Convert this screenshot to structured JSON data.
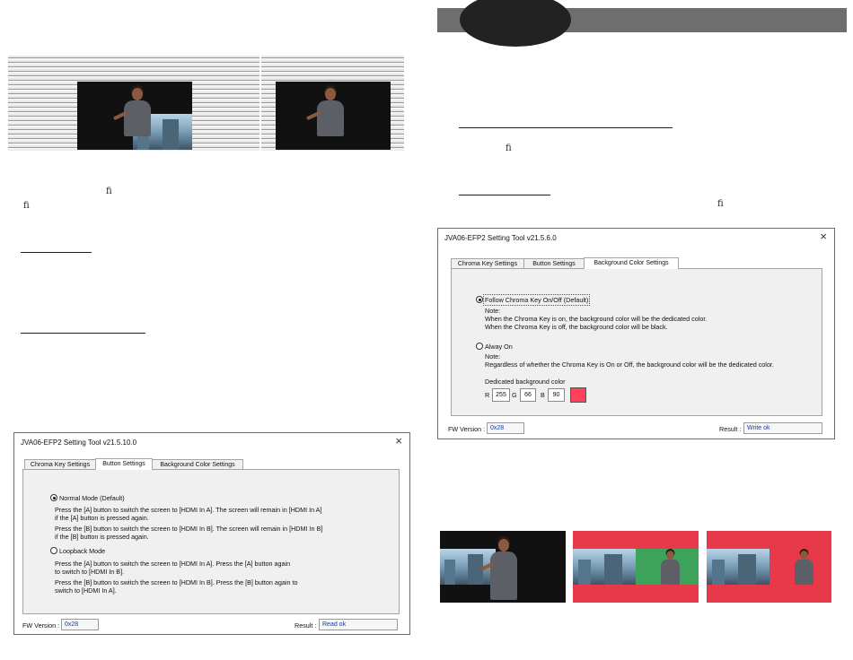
{
  "left_dialog": {
    "title": "JVA06-EFP2 Setting Tool v21.5.10.0",
    "tabs": [
      "Chroma Key Settings",
      "Button Settings",
      "Background Color Settings"
    ],
    "active_tab": "Button Settings",
    "normal_mode_label": "Normal Mode (Default)",
    "normal_lines": [
      "Press the [A] button to switch the screen to [HDMI In A]. The screen will remain in [HDMI In A]",
      "if the [A] button is pressed again.",
      "Press the [B] button to switch the screen to [HDMI In B]. The screen will remain in [HDMI In  B]",
      "if the [B] button is pressed again."
    ],
    "loopback_label": "Loopback Mode",
    "loopback_lines": [
      "Press the [A] button to switch the screen to [HDMI In A]. Press the [A] button again",
      "to switch to [HDMI In B].",
      "Press the [B] button to switch the screen to [HDMI In B]. Press the  [B] button again to",
      "switch to [HDMI In A]."
    ],
    "fw_label": "FW Version :",
    "fw_value": "0x28",
    "result_label": "Result :",
    "result_value": "Read ok"
  },
  "right_dialog": {
    "title": "JVA06-EFP2 Setting Tool v21.5.6.0",
    "tabs": [
      "Chroma Key Settings",
      "Button Settings",
      "Background Color Settings"
    ],
    "active_tab": "Background Color Settings",
    "follow_label": "Follow Chroma Key On/Off (Default)",
    "follow_note": "Note:",
    "follow_lines": [
      "When the Chroma Key is on, the background color will be the dedicated color.",
      "When the Chroma Key is off, the background color will be black."
    ],
    "always_label": "Alway On",
    "always_note": "Note:",
    "always_lines": [
      "Regardless of whether the Chroma Key is On or Off, the background color will be the dedicated color."
    ],
    "dedicated_label": "Dedicated background color",
    "r_label": "R",
    "r_value": "255",
    "g_label": "G",
    "g_value": "66",
    "b_label": "B",
    "b_value": "90",
    "swatch_color": "#ff425a",
    "fw_label": "FW Version :",
    "fw_value": "0x28",
    "result_label": "Result :",
    "result_value": "Write ok"
  },
  "ligatures": [
    "ﬁ",
    "ﬁ",
    "ﬁ",
    "ﬁ"
  ],
  "colors": {
    "header_bar": "#6e6e6e",
    "header_oval": "#222222",
    "chroma_red": "#e8394a",
    "chroma_green": "#3ea35a",
    "value_text": "#1c3c9c"
  }
}
